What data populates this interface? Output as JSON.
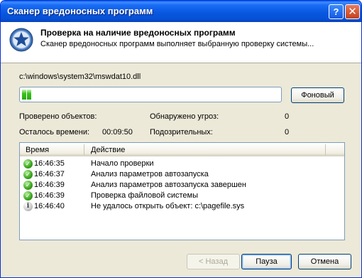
{
  "window": {
    "title": "Сканер вредоносных программ",
    "help_label": "?",
    "close_label": "✕"
  },
  "header": {
    "title": "Проверка на наличие вредоносных программ",
    "subtitle": "Сканер вредоносных программ выполняет выбранную проверку системы..."
  },
  "scan": {
    "current_file": "c:\\windows\\system32\\mswdat10.dll",
    "progress_percent": 3,
    "background_button": "Фоновый"
  },
  "stats": {
    "checked_label": "Проверено объектов:",
    "checked_value": "",
    "remaining_label": "Осталось времени:",
    "remaining_value": "00:09:50",
    "threats_label": "Обнаружено угроз:",
    "threats_value": "0",
    "suspicious_label": "Подозрительных:",
    "suspicious_value": "0"
  },
  "log": {
    "columns": [
      "Время",
      "Действие"
    ],
    "rows": [
      {
        "icon": "ok-icon",
        "time": "16:46:35",
        "action": "Начало проверки"
      },
      {
        "icon": "ok-icon",
        "time": "16:46:37",
        "action": "Анализ параметров автозапуска"
      },
      {
        "icon": "ok-icon",
        "time": "16:46:39",
        "action": "Анализ параметров автозапуска завершен"
      },
      {
        "icon": "ok-icon",
        "time": "16:46:39",
        "action": "Проверка файловой системы"
      },
      {
        "icon": "info-icon",
        "time": "16:46:40",
        "action": "Не удалось открыть объект: c:\\pagefile.sys"
      }
    ]
  },
  "buttons": {
    "back": "< Назад",
    "pause": "Пауза",
    "cancel": "Отмена"
  },
  "colors": {
    "titlebar": "#0858e0",
    "progress_fill": "#38c21c",
    "window_bg": "#ece9d8"
  }
}
